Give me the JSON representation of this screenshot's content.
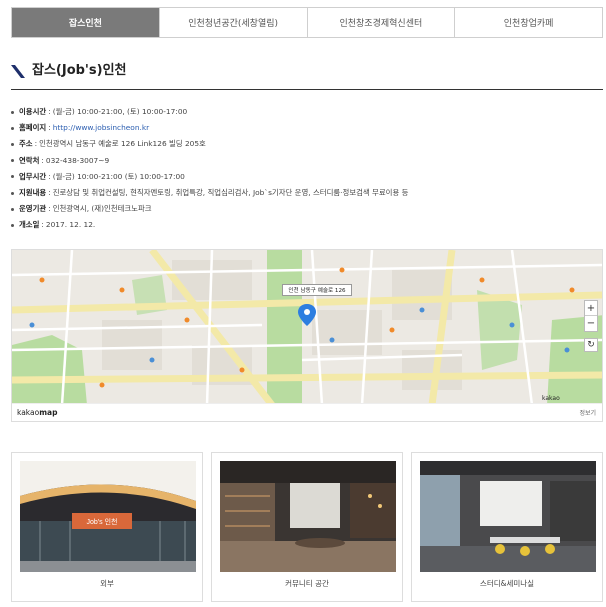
{
  "tabs": [
    {
      "label": "잡스인천",
      "active": true
    },
    {
      "label": "인천청년공간(세창열림)",
      "active": false
    },
    {
      "label": "인천창조경제혁신센터",
      "active": false
    },
    {
      "label": "인천창업카페",
      "active": false
    }
  ],
  "heading": {
    "title": "잡스(Job's)인천"
  },
  "info": [
    {
      "label": "이용시간",
      "value": "(월-금) 10:00-21:00, (토) 10:00-17:00"
    },
    {
      "label": "홈페이지",
      "value": "http://www.jobsincheon.kr",
      "link": true
    },
    {
      "label": "주소",
      "value": "인천광역시 남동구 예술로 126 Link126 빌딩 205호"
    },
    {
      "label": "연락처",
      "value": "032-438-3007~9"
    },
    {
      "label": "업무시간",
      "value": "(월-금) 10:00-21:00 (토) 10:00-17:00"
    },
    {
      "label": "지원내용",
      "value": "진로상담 및 취업컨설팅, 현직자멘토링, 취업특강, 직업심리검사, Job`s기자단 운영, 스터디룸·정보검색 무료이용 등"
    },
    {
      "label": "운영기관",
      "value": "인천광역시, (재)인천테크노파크"
    },
    {
      "label": "개소일",
      "value": "2017. 12. 12."
    }
  ],
  "map": {
    "popup": "인천 남동구 예술로 126",
    "brand_prefix": "kakao",
    "brand_suffix": "map",
    "scale_label": "kakao",
    "meta_label": "정보기",
    "zoom_in": "+",
    "zoom_out": "−",
    "refresh": "↻",
    "colors": {
      "park": "#b8dca0",
      "road_main": "#f3e9a8",
      "road_minor": "#ffffff",
      "ground": "#ece9e3",
      "marker": "#2d7ee0"
    }
  },
  "cards": [
    {
      "caption": "외부",
      "sign": "Job's 인천"
    },
    {
      "caption": "커뮤니티 공간"
    },
    {
      "caption": "스터디&세미나실"
    }
  ]
}
